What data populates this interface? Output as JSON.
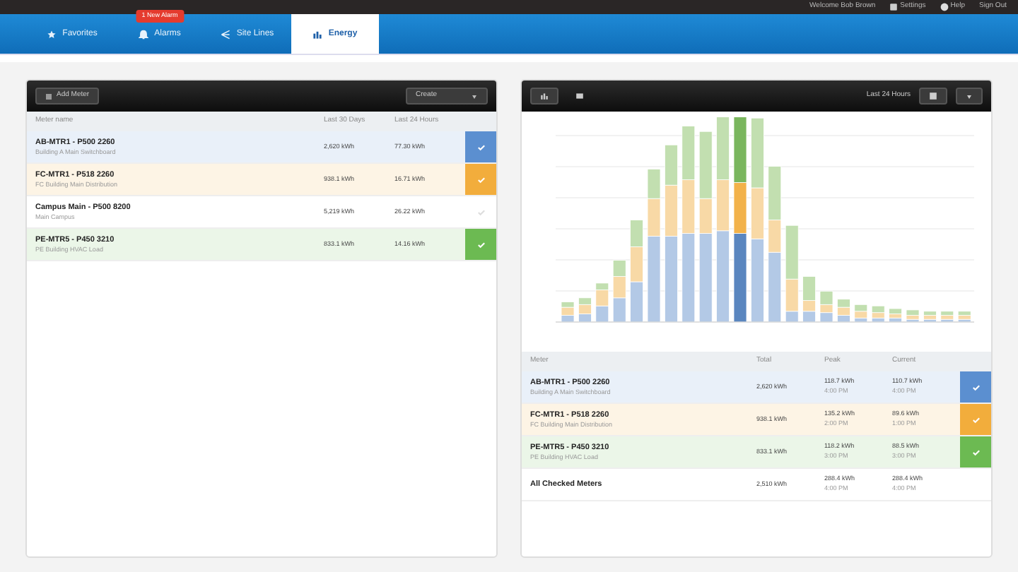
{
  "top_bar": {
    "welcome": "Welcome Bob Brown",
    "links": [
      {
        "kind": "settings",
        "label": "Settings"
      },
      {
        "kind": "help",
        "label": "Help"
      },
      {
        "kind": "plain",
        "label": "Sign Out"
      }
    ]
  },
  "tabs": [
    {
      "kind": "star",
      "label": "Favorites",
      "selected": false
    },
    {
      "kind": "bell",
      "label": "Alarms",
      "selected": false,
      "badge": "1 New Alarm"
    },
    {
      "kind": "network",
      "label": "Site Lines",
      "selected": false
    },
    {
      "kind": "chart",
      "label": "Energy",
      "selected": true
    }
  ],
  "meters_panel": {
    "add_button": "Add Meter",
    "dropdown": "Create",
    "columns": [
      "Meter name",
      "Last 30 Days",
      "Last 24 Hours"
    ],
    "rows": [
      {
        "name": "AB-MTR1 - P500 2260",
        "subtitle": "Building A Main Switchboard",
        "month": "2,620 kWh",
        "day": "77.30 kWh",
        "color": "#5b8fd0"
      },
      {
        "name": "FC-MTR1 - P518 2260",
        "subtitle": "FC Building Main Distribution",
        "month": "938.1 kWh",
        "day": "16.71 kWh",
        "color": "#f2ad3c"
      },
      {
        "name": "Campus Main - P500 8200",
        "subtitle": "Main Campus",
        "month": "5,219 kWh",
        "day": "26.22 kWh"
      },
      {
        "name": "PE-MTR5 - P450 3210",
        "subtitle": "PE Building HVAC Load",
        "month": "833.1 kWh",
        "day": "14.16 kWh",
        "color": "#6cba52"
      }
    ]
  },
  "chart_panel": {
    "range": "Last 24 Hours",
    "columns": [
      "Meter",
      "Total",
      "Peak",
      "Current"
    ],
    "rows": [
      {
        "name": "AB-MTR1 - P500 2260",
        "subtitle": "Building A Main Switchboard",
        "total": "2,620 kWh",
        "peak": "118.7 kWh",
        "peak_time": "4:00 PM",
        "current": "110.7 kWh",
        "current_time": "4:00 PM",
        "color": "#5b8fd0"
      },
      {
        "name": "FC-MTR1 - P518 2260",
        "subtitle": "FC Building Main Distribution",
        "total": "938.1 kWh",
        "peak": "135.2 kWh",
        "peak_time": "2:00 PM",
        "current": "89.6 kWh",
        "current_time": "1:00 PM",
        "color": "#f2ad3c"
      },
      {
        "name": "PE-MTR5 - P450 3210",
        "subtitle": "PE Building HVAC Load",
        "total": "833.1 kWh",
        "peak": "118.2 kWh",
        "peak_time": "3:00 PM",
        "current": "88.5 kWh",
        "current_time": "3:00 PM",
        "color": "#6cba52"
      },
      {
        "name": "All Checked Meters",
        "total": "2,510 kWh",
        "peak": "288.4 kWh",
        "peak_time": "4:00 PM",
        "current": "288.4 kWh",
        "current_time": "4:00 PM"
      }
    ]
  }
}
